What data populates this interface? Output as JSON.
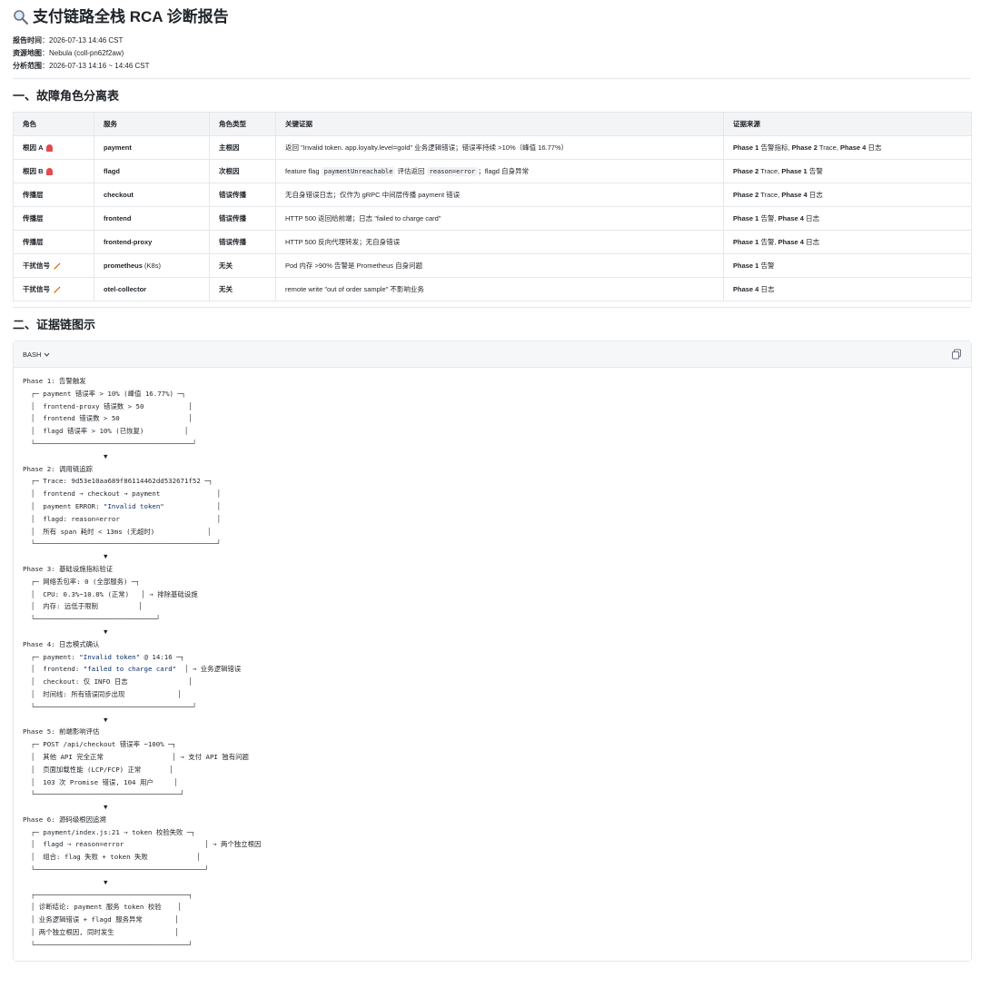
{
  "report": {
    "title": "支付链路全栈 RCA 诊断报告",
    "meta": [
      {
        "label": "报告时间",
        "value": "2026-07-13 14:46 CST"
      },
      {
        "label": "资源地图",
        "value": "Nebula (coll-pn62f2aw)"
      },
      {
        "label": "分析范围",
        "value": "2026-07-13 14:16 ~ 14:46 CST"
      }
    ]
  },
  "section1": {
    "title": "一、故障角色分离表",
    "headers": [
      "角色",
      "服务",
      "角色类型",
      "关键证据",
      "证据来源"
    ],
    "rows": [
      {
        "role": "根因 A",
        "role_icon": "siren-icon",
        "service": "payment",
        "type": "主根因",
        "evidence": "返回 \"Invalid token. app.loyalty.level=gold\" 业务逻辑错误；错误率持续 >10%（峰值 16.77%）",
        "source": [
          [
            "Phase 1",
            " 告警指标, "
          ],
          [
            "Phase 2",
            " Trace, "
          ],
          [
            "Phase 4",
            " 日志"
          ]
        ]
      },
      {
        "role": "根因 B",
        "role_icon": "siren-icon",
        "service": "flagd",
        "type": "次根因",
        "evidence_parts": [
          "feature flag ",
          "paymentUnreachable",
          " 评估返回 ",
          "reason=error",
          "；flagd 自身异常"
        ],
        "source": [
          [
            "Phase 2",
            " Trace, "
          ],
          [
            "Phase 1",
            " 告警"
          ]
        ]
      },
      {
        "role": "传播层",
        "service": "checkout",
        "type": "错误传播",
        "evidence": "无自身错误日志；仅作为 gRPC 中间层传播 payment 错误",
        "source": [
          [
            "Phase 2",
            " Trace, "
          ],
          [
            "Phase 4",
            " 日志"
          ]
        ]
      },
      {
        "role": "传播层",
        "service": "frontend",
        "type": "错误传播",
        "evidence": "HTTP 500 返回给前端；日志 \"failed to charge card\"",
        "source": [
          [
            "Phase 1",
            " 告警, "
          ],
          [
            "Phase 4",
            " 日志"
          ]
        ]
      },
      {
        "role": "传播层",
        "service": "frontend-proxy",
        "type": "错误传播",
        "evidence": "HTTP 500 反向代理转发；无自身错误",
        "source": [
          [
            "Phase 1",
            " 告警, "
          ],
          [
            "Phase 4",
            " 日志"
          ]
        ]
      },
      {
        "role": "干扰信号",
        "role_icon": "broom-icon",
        "service": "prometheus",
        "service_suffix": " (K8s)",
        "type": "无关",
        "evidence": "Pod 内存 >90% 告警是 Prometheus 自身问题",
        "source": [
          [
            "Phase 1",
            " 告警"
          ]
        ]
      },
      {
        "role": "干扰信号",
        "role_icon": "broom-icon",
        "service": "otel-collector",
        "type": "无关",
        "evidence": "remote write \"out of order sample\" 不影响业务",
        "source": [
          [
            "Phase 4",
            " 日志"
          ]
        ]
      }
    ]
  },
  "section2": {
    "title": "二、证据链图示",
    "code_lang": "BASH",
    "lines": [
      "Phase 1: 告警触发",
      "  ┌─ payment 错误率 > 10% (峰值 16.77%) ─┐",
      "  │  frontend-proxy 错误数 > 50           │",
      "  │  frontend 错误数 > 50                 │",
      "  │  flagd 错误率 > 10% (已恢复)          │",
      "  └───────────────────────────────────────┘",
      "                    ▼",
      "Phase 2: 调用链追踪",
      "  ┌─ Trace: 9d53e10aa689f86114462dd532671f52 ─┐",
      "  │  frontend → checkout → payment              │",
      "  │  payment ERROR: \"Invalid token\"             │",
      "  │  flagd: reason=error                        │",
      "  │  所有 span 耗时 < 13ms (无超时)             │",
      "  └─────────────────────────────────────────────┘",
      "                    ▼",
      "Phase 3: 基础设施指标验证",
      "  ┌─ 网络丢包率: 0 (全部服务) ─┐",
      "  │  CPU: 0.3%~10.8% (正常)   │ → 排除基础设施",
      "  │  内存: 远低于限制          │",
      "  └──────────────────────────────┘",
      "                    ▼",
      "Phase 4: 日志模式确认",
      "  ┌─ payment: \"Invalid token\" @ 14:16 ─┐",
      "  │  frontend: \"failed to charge card\"  │ → 业务逻辑错误",
      "  │  checkout: 仅 INFO 日志               │",
      "  │  时间线: 所有错误同步出现             │",
      "  └───────────────────────────────────────┘",
      "                    ▼",
      "Phase 5: 前端影响评估",
      "  ┌─ POST /api/checkout 错误率 ~100% ─┐",
      "  │  其他 API 完全正常                 │ → 支付 API 独有问题",
      "  │  页面加载性能 (LCP/FCP) 正常       │",
      "  │  103 次 Promise 错误, 104 用户     │",
      "  └────────────────────────────────────┘",
      "                    ▼",
      "Phase 6: 源码级根因追溯",
      "  ┌─ payment/index.js:21 → token 校验失败 ─┐",
      "  │  flagd → reason=error                    │ → 两个独立根因",
      "  │  组合: flag 失败 + token 失败            │",
      "  └──────────────────────────────────────────┘",
      "                    ▼",
      "  ┌──────────────────────────────────────┐",
      "  │ 诊断结论: payment 服务 token 校验    │",
      "  │ 业务逻辑错误 + flagd 服务异常        │",
      "  │ 两个独立根因, 同时发生               │",
      "  └──────────────────────────────────────┘"
    ]
  }
}
